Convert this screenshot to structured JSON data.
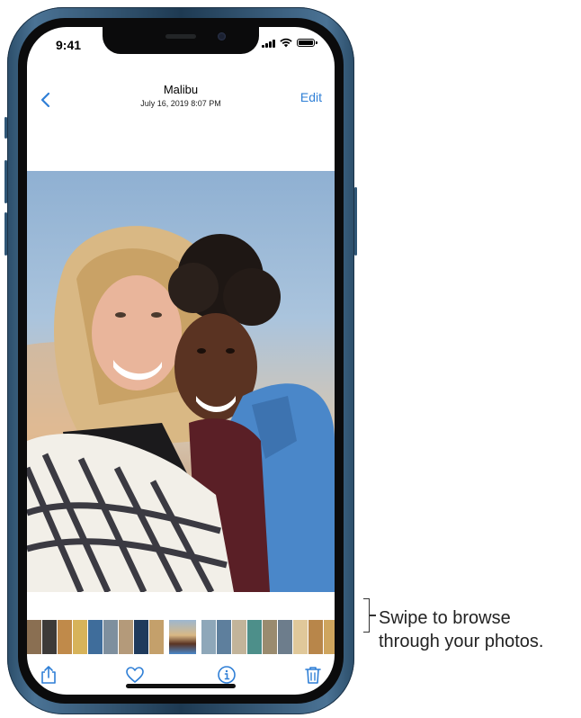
{
  "status_bar": {
    "time": "9:41"
  },
  "nav": {
    "back_icon": "chevron-left-icon",
    "title": "Malibu",
    "subtitle": "July 16, 2019  8:07 PM",
    "edit_label": "Edit"
  },
  "photo": {
    "description_icon": "photo-two-friends"
  },
  "toolbar": {
    "share_icon": "share-icon",
    "favorite_icon": "heart-icon",
    "info_icon": "info-icon",
    "delete_icon": "trash-icon"
  },
  "callout": {
    "line1": "Swipe to browse",
    "line2": "through your photos."
  },
  "colors": {
    "accent": "#2f7fd6",
    "frame": "#2c4e6a"
  }
}
